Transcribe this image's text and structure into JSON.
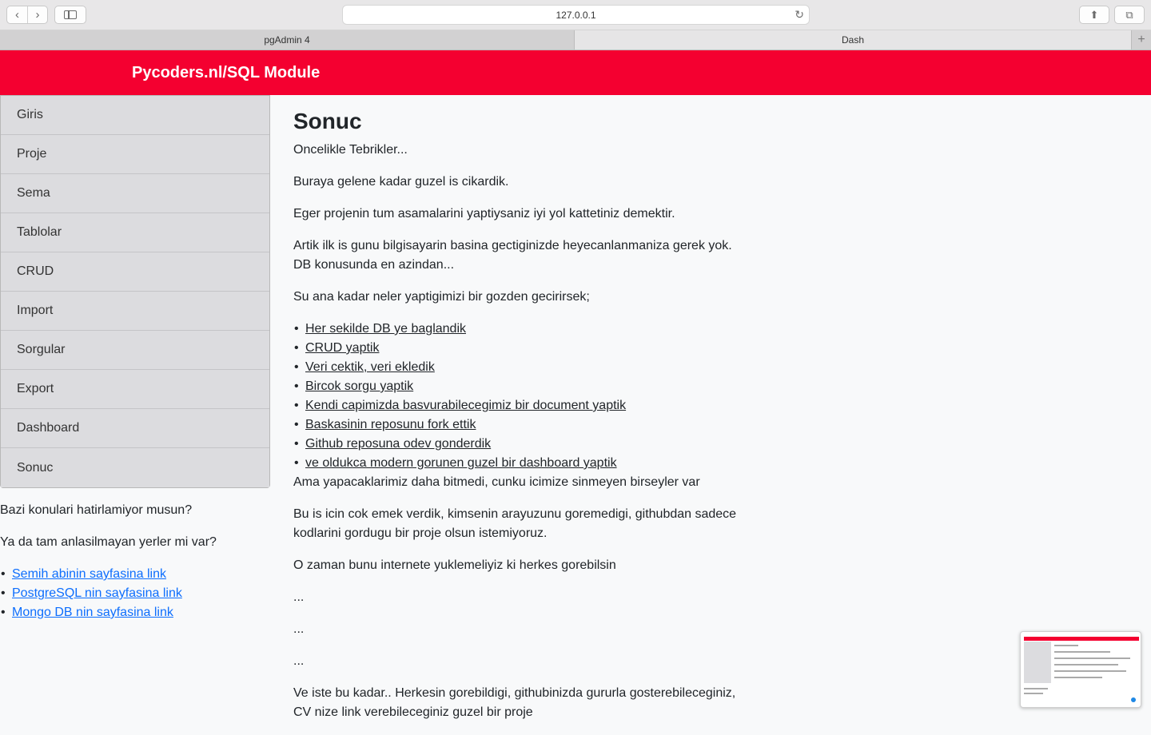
{
  "browser": {
    "url": "127.0.0.1",
    "tabs": [
      {
        "label": "pgAdmin 4"
      },
      {
        "label": "Dash"
      }
    ],
    "new_tab_label": "+"
  },
  "header": {
    "title": "Pycoders.nl/SQL Module"
  },
  "sidebar": {
    "items": [
      {
        "label": "Giris"
      },
      {
        "label": "Proje"
      },
      {
        "label": "Sema"
      },
      {
        "label": "Tablolar"
      },
      {
        "label": "CRUD"
      },
      {
        "label": "Import"
      },
      {
        "label": "Sorgular"
      },
      {
        "label": "Export"
      },
      {
        "label": "Dashboard"
      },
      {
        "label": "Sonuc"
      }
    ],
    "notes": {
      "question1": "Bazi konulari hatirlamiyor musun?",
      "question2": "Ya da tam anlasilmayan yerler mi var?",
      "links": [
        {
          "label": "Semih abinin sayfasina link"
        },
        {
          "label": "PostgreSQL nin sayfasina link"
        },
        {
          "label": "Mongo DB nin sayfasina link"
        }
      ]
    }
  },
  "main": {
    "title": "Sonuc",
    "p1": "Oncelikle Tebrikler...",
    "p2": "Buraya gelene kadar guzel is cikardik.",
    "p3": "Eger projenin tum asamalarini yaptiysaniz iyi yol kattetiniz demektir.",
    "p4": "Artik ilk is gunu bilgisayarin basina gectiginizde heyecanlanmaniza gerek yok. DB konusunda en azindan...",
    "p5": "Su ana kadar neler yaptigimizi bir gozden gecirirsek;",
    "achievements": [
      {
        "label": "Her sekilde DB ye baglandik"
      },
      {
        "label": "CRUD yaptik"
      },
      {
        "label": "Veri cektik, veri ekledik"
      },
      {
        "label": "Bircok sorgu yaptik"
      },
      {
        "label": "Kendi capimizda basvurabilecegimiz bir document yaptik"
      },
      {
        "label": "Baskasinin reposunu fork ettik"
      },
      {
        "label": "Github reposuna odev gonderdik"
      },
      {
        "label": "ve oldukca modern gorunen guzel bir dashboard yaptik"
      }
    ],
    "p6": "Ama yapacaklarimiz daha bitmedi, cunku icimize sinmeyen birseyler var",
    "p7": "Bu is icin cok emek verdik, kimsenin arayuzunu goremedigi, githubdan sadece kodlarini gordugu bir proje olsun istemiyoruz.",
    "p8": "O zaman bunu internete yuklemeliyiz ki herkes gorebilsin",
    "ellipsis1": "...",
    "ellipsis2": "...",
    "ellipsis3": "...",
    "p9": "Ve iste bu kadar.. Herkesin gorebildigi, githubinizda gururla gosterebileceginiz, CV nize link verebileceginiz guzel bir proje"
  },
  "colors": {
    "accent": "#f40030",
    "link": "#0d6efd"
  },
  "icons": [
    "back-icon",
    "forward-icon",
    "sidebar-toggle-icon",
    "reload-icon",
    "share-icon",
    "tabs-overview-icon"
  ]
}
